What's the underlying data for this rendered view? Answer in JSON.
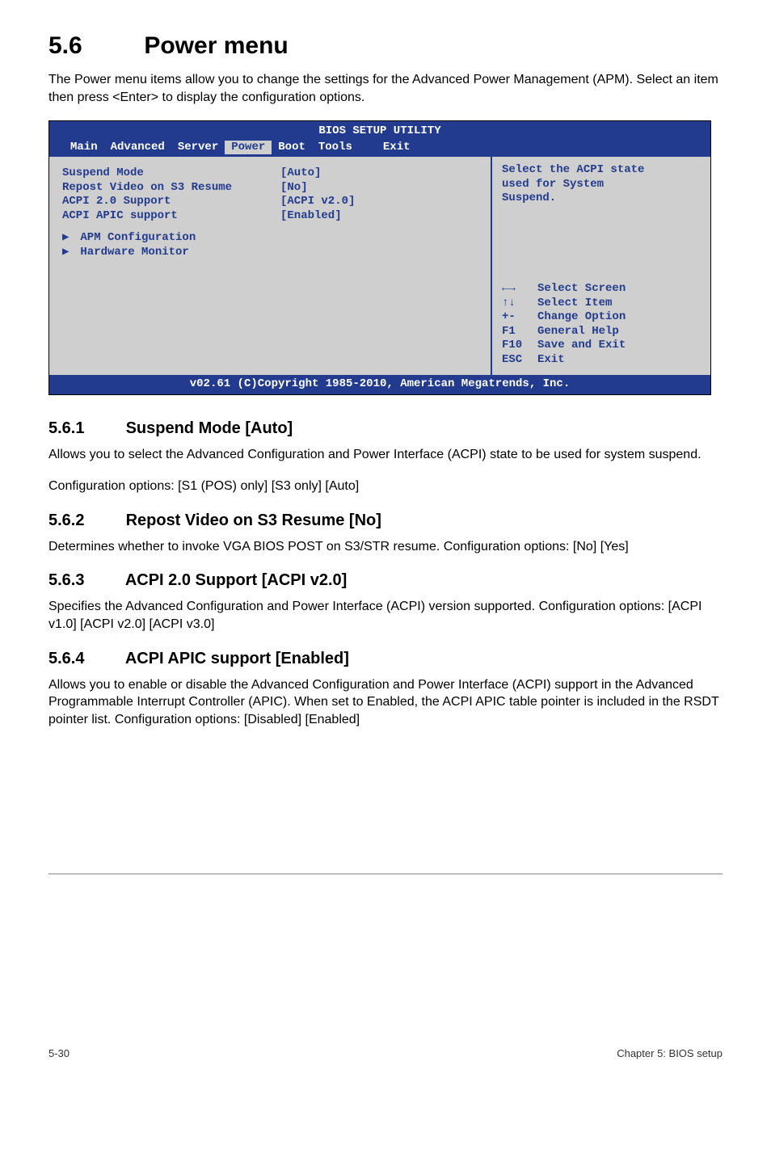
{
  "chapter": {
    "num": "5.6",
    "title": "Power menu"
  },
  "intro": "The Power menu items allow you to change the settings for the Advanced Power Management (APM). Select an item then press <Enter> to display the configuration options.",
  "bios": {
    "header_title": "BIOS SETUP UTILITY",
    "tabs": {
      "main": "Main",
      "advanced": "Advanced",
      "server": "Server",
      "power": "Power",
      "boot": "Boot",
      "tools": "Tools",
      "exit": "Exit"
    },
    "settings": [
      {
        "label": "Suspend Mode",
        "value": "[Auto]"
      },
      {
        "label": "Repost Video on S3 Resume",
        "value": "[No]"
      },
      {
        "label": "ACPI 2.0 Support",
        "value": "[ACPI v2.0]"
      },
      {
        "label": "ACPI APIC support",
        "value": "[Enabled]"
      }
    ],
    "submenus": [
      "APM Configuration",
      "Hardware Monitor"
    ],
    "help": {
      "line1": "Select the ACPI state",
      "line2": "used for System",
      "line3": "Suspend."
    },
    "keys": [
      {
        "k": "←→",
        "d": "Select Screen"
      },
      {
        "k": "↑↓",
        "d": "Select Item"
      },
      {
        "k": "+-",
        "d": "Change Option"
      },
      {
        "k": "F1",
        "d": "General Help"
      },
      {
        "k": "F10",
        "d": "Save and Exit"
      },
      {
        "k": "ESC",
        "d": "Exit"
      }
    ],
    "footer": "v02.61 (C)Copyright 1985-2010, American Megatrends, Inc."
  },
  "sections": {
    "s1": {
      "num": "5.6.1",
      "title": "Suspend Mode [Auto]",
      "p1": "Allows you to select the Advanced Configuration and Power Interface (ACPI) state to be used for system suspend.",
      "p2": "Configuration options: [S1 (POS) only] [S3 only] [Auto]"
    },
    "s2": {
      "num": "5.6.2",
      "title": "Repost Video on S3 Resume [No]",
      "p1": "Determines whether to invoke VGA BIOS POST on S3/STR resume. Configuration options: [No] [Yes]"
    },
    "s3": {
      "num": "5.6.3",
      "title": "ACPI 2.0 Support [ACPI v2.0]",
      "p1": "Specifies the Advanced Configuration and Power Interface (ACPI) version supported. Configuration options: [ACPI v1.0] [ACPI v2.0] [ACPI v3.0]"
    },
    "s4": {
      "num": "5.6.4",
      "title": "ACPI APIC support [Enabled]",
      "p1": "Allows you to enable or disable the Advanced Configuration and Power Interface (ACPI) support in the Advanced Programmable Interrupt Controller (APIC). When set to Enabled, the ACPI APIC table pointer is included in the RSDT pointer list. Configuration options: [Disabled] [Enabled]"
    }
  },
  "footer": {
    "left": "5-30",
    "right": "Chapter 5: BIOS setup"
  }
}
